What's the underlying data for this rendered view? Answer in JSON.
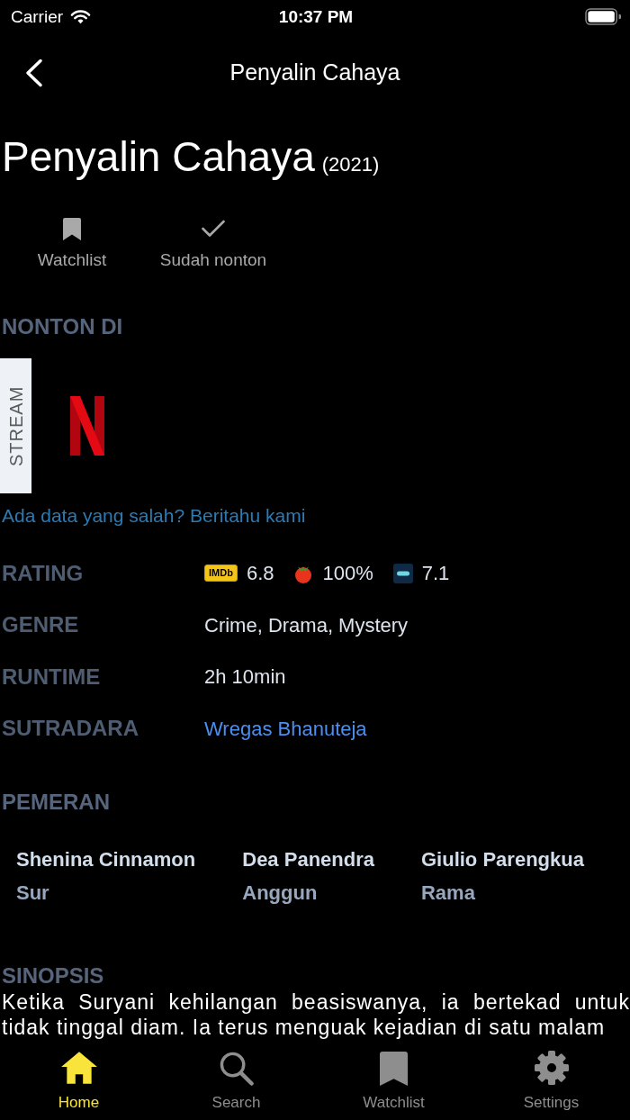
{
  "status_bar": {
    "carrier": "Carrier",
    "time": "10:37 PM"
  },
  "nav_bar": {
    "title": "Penyalin Cahaya"
  },
  "header": {
    "title": "Penyalin Cahaya",
    "year": "(2021)"
  },
  "actions": [
    {
      "kind": "watchlist",
      "label": "Watchlist"
    },
    {
      "kind": "watched",
      "label": "Sudah nonton"
    }
  ],
  "where_to_watch": {
    "heading": "NONTON DI",
    "groups": [
      {
        "label": "STREAM",
        "providers": [
          {
            "kind": "netflix"
          }
        ]
      }
    ],
    "report_link": "Ada data yang salah? Beritahu kami"
  },
  "details": [
    {
      "kind": "ratings",
      "label": "RATING",
      "ratings": [
        {
          "kind": "imdb",
          "logo_text": "IMDb",
          "score": "6.8"
        },
        {
          "kind": "tomato",
          "score": "100%"
        },
        {
          "kind": "tile",
          "score": "7.1"
        }
      ]
    },
    {
      "kind": "text",
      "label": "GENRE",
      "value": "Crime, Drama, Mystery"
    },
    {
      "kind": "text",
      "label": "RUNTIME",
      "value": "2h 10min"
    },
    {
      "kind": "link",
      "label": "SUTRADARA",
      "value": "Wregas Bhanuteja"
    }
  ],
  "cast": {
    "heading": "PEMERAN",
    "members": [
      {
        "name": "Shenina Cinnamon",
        "role": "Sur"
      },
      {
        "name": "Dea Panendra",
        "role": "Anggun"
      },
      {
        "name": "Giulio Parengkua",
        "role": "Rama"
      }
    ]
  },
  "synopsis": {
    "heading": "SINOPSIS",
    "text": "Ketika Suryani kehilangan beasiswanya, ia bertekad untuk tidak tinggal diam. Ia terus menguak kejadian di satu malam"
  },
  "tab_bar": {
    "tabs": [
      {
        "kind": "home",
        "label": "Home",
        "selected": true
      },
      {
        "kind": "search",
        "label": "Search",
        "selected": false
      },
      {
        "kind": "watchlist",
        "label": "Watchlist",
        "selected": false
      },
      {
        "kind": "settings",
        "label": "Settings",
        "selected": false
      }
    ]
  }
}
